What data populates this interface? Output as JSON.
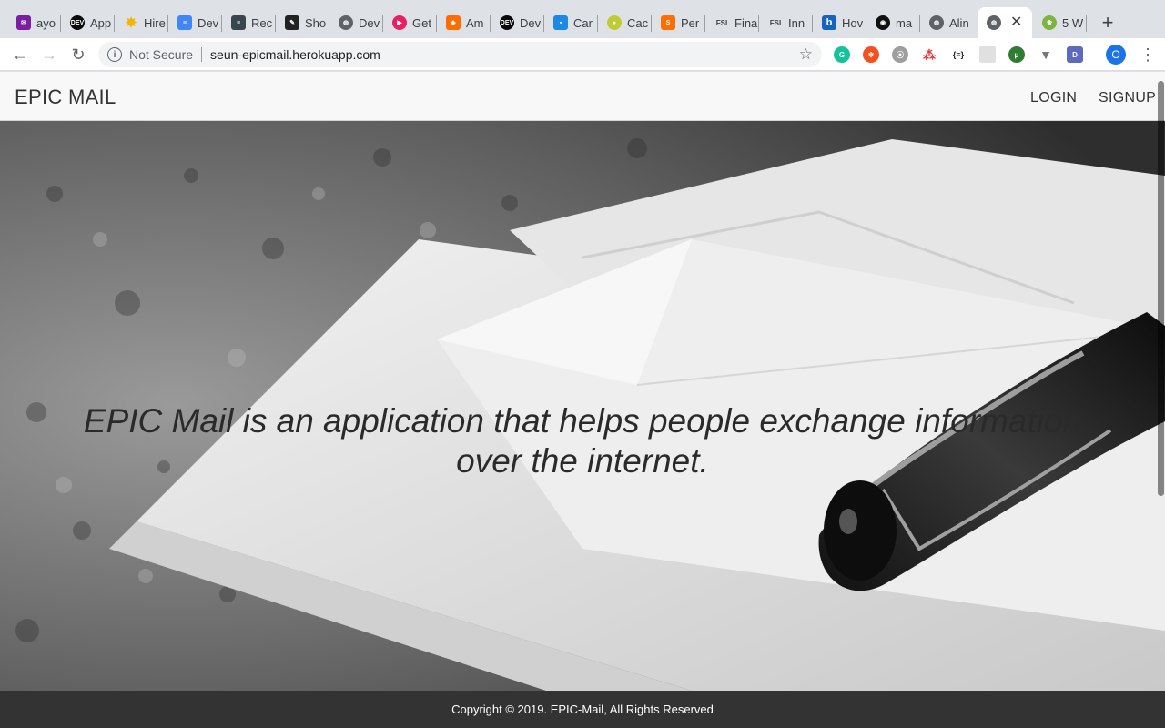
{
  "browser": {
    "tabs": [
      {
        "title": "ayo",
        "icon": "gmail-icon",
        "color": "#7b1fa2"
      },
      {
        "title": "App",
        "icon": "dev-icon",
        "color": "#0a0a0a"
      },
      {
        "title": "Hire",
        "icon": "star-burst-icon",
        "color": "#f4b400"
      },
      {
        "title": "Dev",
        "icon": "google-docs-icon",
        "color": "#4285f4"
      },
      {
        "title": "Rec",
        "icon": "notes-icon",
        "color": "#37474f"
      },
      {
        "title": "Sho",
        "icon": "pen-square-icon",
        "color": "#222222"
      },
      {
        "title": "Dev",
        "icon": "globe-icon",
        "color": "#5f6368"
      },
      {
        "title": "Get",
        "icon": "play-circle-icon",
        "color": "#e91e63"
      },
      {
        "title": "Am",
        "icon": "cube-icon",
        "color": "#ff6d00"
      },
      {
        "title": "Dev",
        "icon": "dev-icon",
        "color": "#0a0a0a"
      },
      {
        "title": "Car",
        "icon": "card-icon",
        "color": "#1e88e5"
      },
      {
        "title": "Cac",
        "icon": "cake-icon",
        "color": "#c0ca33"
      },
      {
        "title": "Per",
        "icon": "sublime-icon",
        "color": "#ff6f00"
      },
      {
        "title": "Fina",
        "icon": "fsi-icon",
        "color": "#424242"
      },
      {
        "title": "Inn",
        "icon": "fsi-icon",
        "color": "#424242"
      },
      {
        "title": "Hov",
        "icon": "bing-icon",
        "color": "#1565c0"
      },
      {
        "title": "ma",
        "icon": "github-icon",
        "color": "#111111"
      },
      {
        "title": "Alin",
        "icon": "globe-icon",
        "color": "#5f6368"
      },
      {
        "title": "",
        "icon": "globe-icon",
        "color": "#5f6368",
        "active": true
      },
      {
        "title": "5 W",
        "icon": "leaf-icon",
        "color": "#7cb342"
      }
    ],
    "security_label": "Not Secure",
    "url": "seun-epicmail.herokuapp.com",
    "profile_initial": "O"
  },
  "site": {
    "brand": "EPIC MAIL",
    "nav": {
      "login": "LOGIN",
      "signup": "SIGNUP"
    },
    "tagline_line1": "EPIC Mail is an application that helps people exchange information",
    "tagline_line2": "over the internet.",
    "footer": "Copyright © 2019. EPIC-Mail, All Rights Reserved"
  }
}
